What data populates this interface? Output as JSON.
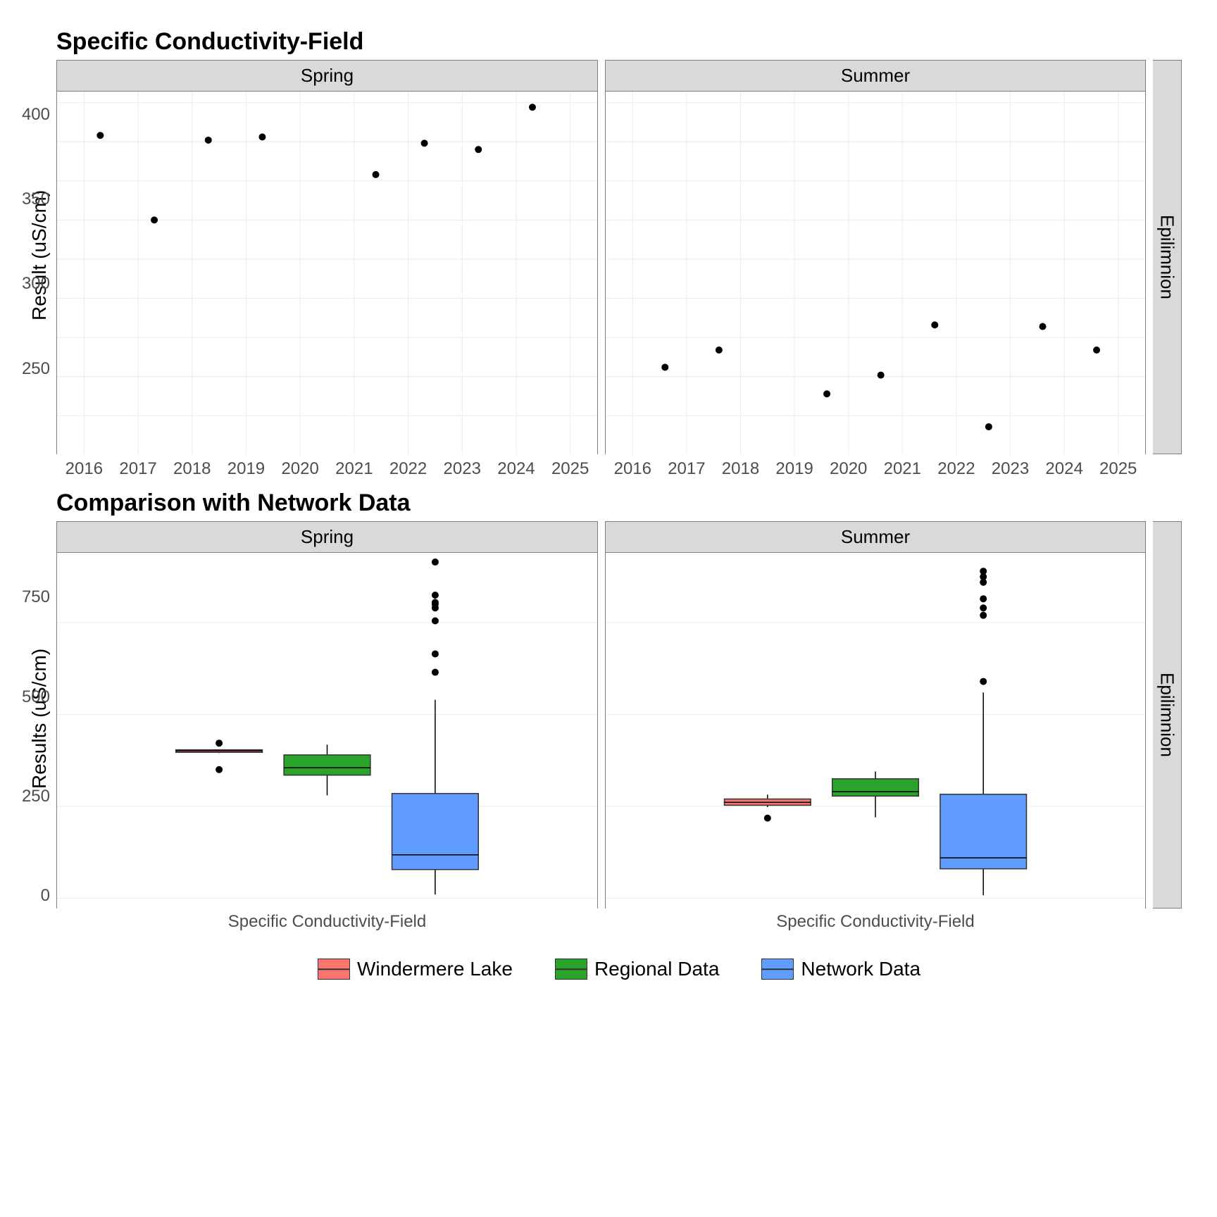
{
  "chart_data": [
    {
      "type": "scatter",
      "title": "Specific Conductivity-Field",
      "facet_col": [
        "Spring",
        "Summer"
      ],
      "facet_row": [
        "Epilimnion"
      ],
      "xlabel": "",
      "ylabel": "Result (uS/cm)",
      "xlim": [
        2015.5,
        2025.5
      ],
      "ylim": [
        200,
        432
      ],
      "xticks": [
        2016,
        2017,
        2018,
        2019,
        2020,
        2021,
        2022,
        2023,
        2024,
        2025
      ],
      "yticks": [
        250,
        300,
        350,
        400
      ],
      "series": [
        {
          "name": "Spring",
          "points": [
            {
              "x": 2016.3,
              "y": 404
            },
            {
              "x": 2017.3,
              "y": 350
            },
            {
              "x": 2018.3,
              "y": 401
            },
            {
              "x": 2019.3,
              "y": 403
            },
            {
              "x": 2021.4,
              "y": 379
            },
            {
              "x": 2022.3,
              "y": 399
            },
            {
              "x": 2023.3,
              "y": 395
            },
            {
              "x": 2024.3,
              "y": 422
            }
          ]
        },
        {
          "name": "Summer",
          "points": [
            {
              "x": 2016.6,
              "y": 256
            },
            {
              "x": 2017.6,
              "y": 267
            },
            {
              "x": 2019.6,
              "y": 239
            },
            {
              "x": 2020.6,
              "y": 251
            },
            {
              "x": 2021.6,
              "y": 283
            },
            {
              "x": 2022.6,
              "y": 218
            },
            {
              "x": 2023.6,
              "y": 282
            },
            {
              "x": 2024.6,
              "y": 267
            }
          ]
        }
      ]
    },
    {
      "type": "box",
      "title": "Comparison with Network Data",
      "facet_col": [
        "Spring",
        "Summer"
      ],
      "facet_row": [
        "Epilimnion"
      ],
      "xlabel": "Specific Conductivity-Field",
      "ylabel": "Results (uS/cm)",
      "xcategory": "Specific Conductivity-Field",
      "ylim": [
        -30,
        940
      ],
      "yticks": [
        0,
        250,
        500,
        750
      ],
      "groups": [
        "Windermere Lake",
        "Regional Data",
        "Network Data"
      ],
      "colors": {
        "Windermere Lake": "#f8766d",
        "Regional Data": "#29a329",
        "Network Data": "#619cff"
      },
      "data": {
        "Spring": [
          {
            "group": "Windermere Lake",
            "min": 395,
            "q1": 397,
            "med": 401,
            "q3": 404,
            "max": 404,
            "out": [
              350,
              422
            ]
          },
          {
            "group": "Regional Data",
            "min": 280,
            "q1": 335,
            "med": 355,
            "q3": 390,
            "max": 418,
            "out": []
          },
          {
            "group": "Network Data",
            "min": 10,
            "q1": 78,
            "med": 118,
            "q3": 285,
            "max": 540,
            "out": [
              615,
              665,
              755,
              790,
              800,
              805,
              825,
              915
            ]
          }
        ],
        "Summer": [
          {
            "group": "Windermere Lake",
            "min": 248,
            "q1": 253,
            "med": 261,
            "q3": 270,
            "max": 282,
            "out": [
              218
            ]
          },
          {
            "group": "Regional Data",
            "min": 220,
            "q1": 278,
            "med": 290,
            "q3": 325,
            "max": 345,
            "out": []
          },
          {
            "group": "Network Data",
            "min": 8,
            "q1": 80,
            "med": 110,
            "q3": 283,
            "max": 560,
            "out": [
              590,
              770,
              790,
              815,
              860,
              875,
              890
            ]
          }
        ]
      }
    }
  ],
  "top_title": "Specific Conductivity-Field",
  "bottom_title": "Comparison with Network Data",
  "ylabel_top": "Result (uS/cm)",
  "ylabel_bot": "Results (uS/cm)",
  "facet_row_label": "Epilimnion",
  "legend": [
    "Windermere Lake",
    "Regional Data",
    "Network Data"
  ]
}
